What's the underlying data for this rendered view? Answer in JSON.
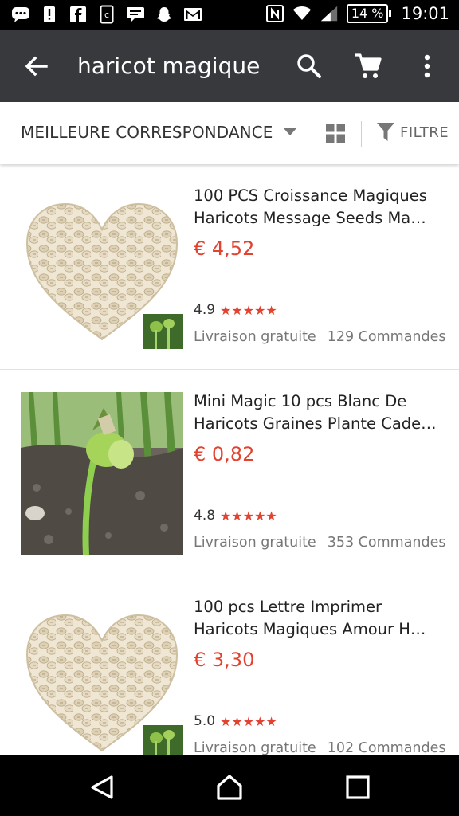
{
  "status_bar": {
    "icons_left": [
      "chat-icon",
      "alert-icon",
      "facebook-icon",
      "c-icon",
      "message-icon",
      "snapchat-icon",
      "gmail-icon"
    ],
    "icons_right": [
      "nfc-icon",
      "wifi-icon",
      "signal-icon"
    ],
    "battery": "14 %",
    "time": "19:01"
  },
  "app_bar": {
    "search_query": "haricot magique",
    "background": "#37393d"
  },
  "sort_bar": {
    "sort_label": "MEILLEURE CORRESPONDANCE",
    "filter_label": "FILTRE"
  },
  "products": [
    {
      "title": "100 PCS Croissance Magiques Haricots Message Seeds Ma…",
      "price": "€ 4,52",
      "rating": "4.9",
      "stars": "★★★★★",
      "shipping": "Livraison gratuite",
      "orders": "129 Commandes",
      "image": "heart-beans"
    },
    {
      "title": "Mini Magic 10 pcs Blanc De Haricots Graines Plante Cade…",
      "price": "€ 0,82",
      "rating": "4.8",
      "stars": "★★★★★",
      "shipping": "Livraison gratuite",
      "orders": "353 Commandes",
      "image": "sprout"
    },
    {
      "title": "100 pcs Lettre Imprimer Haricots Magiques Amour H…",
      "price": "€ 3,30",
      "rating": "5.0",
      "stars": "★★★★★",
      "shipping": "Livraison gratuite",
      "orders": "102 Commandes",
      "image": "heart-beans"
    }
  ],
  "colors": {
    "price": "#e2422f",
    "stars": "#e2422f"
  }
}
